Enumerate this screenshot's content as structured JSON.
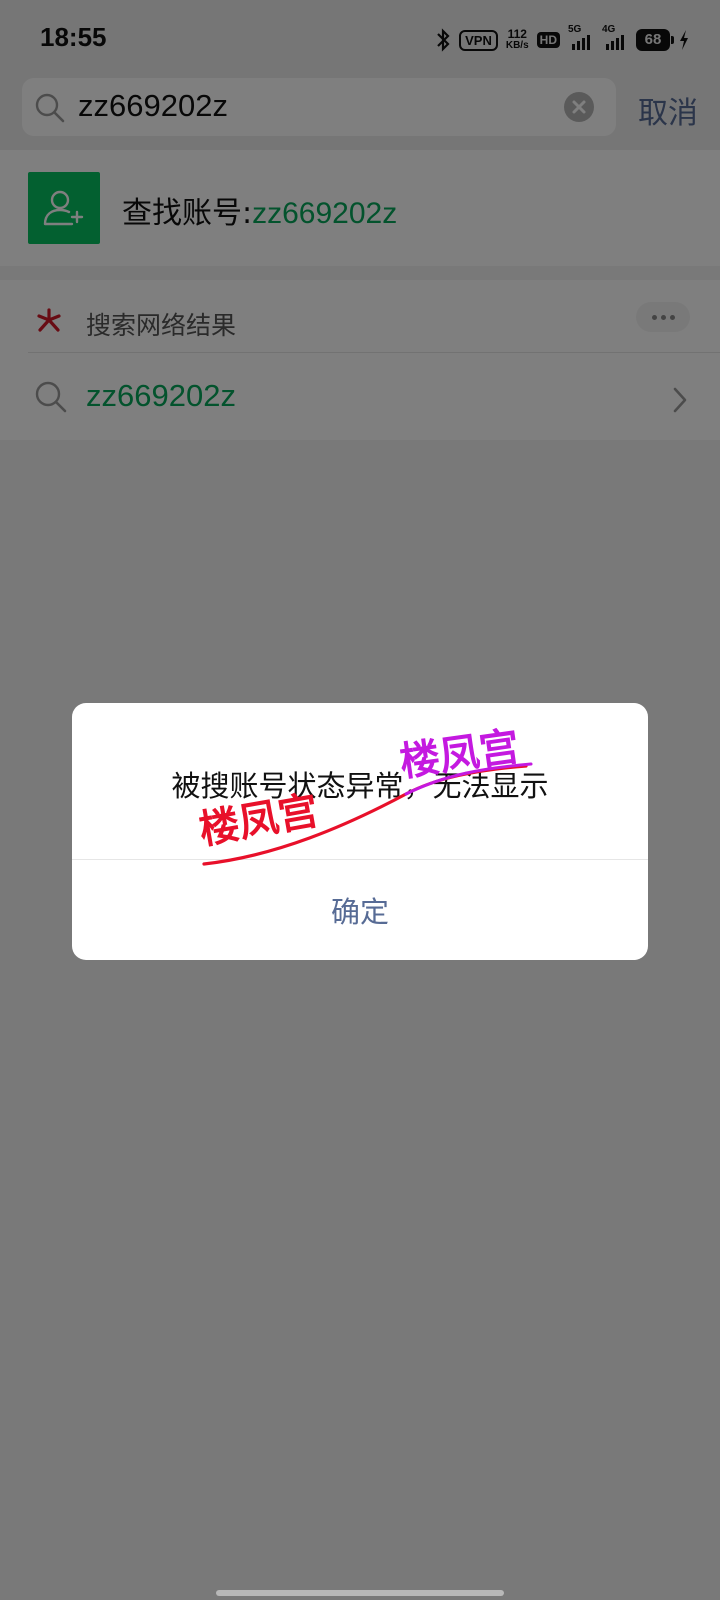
{
  "status_bar": {
    "time": "18:55",
    "vpn": "VPN",
    "speed_value": "112",
    "speed_unit": "KB/s",
    "hd": "HD",
    "net1": "5G",
    "net2": "4G",
    "battery": "68"
  },
  "search": {
    "query": "zz669202z",
    "cancel_label": "取消"
  },
  "find_account": {
    "label": "查找账号:",
    "value": "zz669202z"
  },
  "web_results": {
    "header": "搜索网络结果",
    "result": "zz669202z"
  },
  "dialog": {
    "message": "被搜账号状态异常，无法显示",
    "ok_label": "确定"
  },
  "watermark": {
    "text1": "楼凤宫",
    "text2": "楼凤宫"
  },
  "colors": {
    "accent_green": "#07c160",
    "link_blue": "#576b95",
    "watermark_red": "#e8102a",
    "watermark_purple": "#c419e0"
  },
  "icons": [
    "bluetooth-icon",
    "search-icon",
    "clear-icon",
    "add-friend-icon",
    "web-search-logo-icon",
    "more-icon",
    "chevron-right-icon"
  ]
}
